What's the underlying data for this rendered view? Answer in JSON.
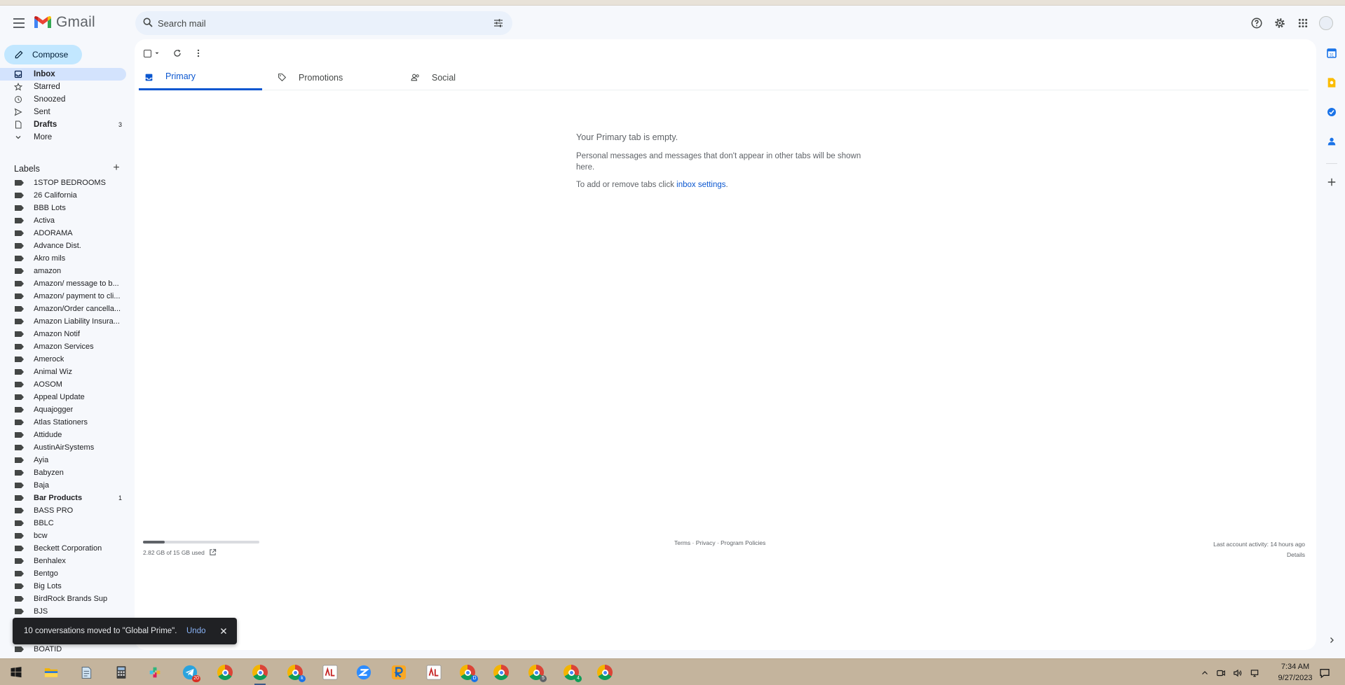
{
  "app": {
    "name": "Gmail"
  },
  "search": {
    "placeholder": "Search mail"
  },
  "compose": {
    "label": "Compose"
  },
  "nav": [
    {
      "label": "Inbox",
      "icon": "inbox-icon",
      "active": true,
      "bold": true
    },
    {
      "label": "Starred",
      "icon": "star-icon"
    },
    {
      "label": "Snoozed",
      "icon": "clock-icon"
    },
    {
      "label": "Sent",
      "icon": "send-icon"
    },
    {
      "label": "Drafts",
      "icon": "draft-icon",
      "count": "3",
      "bold": true
    },
    {
      "label": "More",
      "icon": "chevron-down-icon"
    }
  ],
  "labels": {
    "heading": "Labels",
    "items": [
      {
        "label": "1STOP BEDROOMS"
      },
      {
        "label": "26 California"
      },
      {
        "label": "BBB Lots"
      },
      {
        "label": "Activa"
      },
      {
        "label": "ADORAMA"
      },
      {
        "label": "Advance Dist."
      },
      {
        "label": "Akro mils"
      },
      {
        "label": "amazon"
      },
      {
        "label": "Amazon/ message to b..."
      },
      {
        "label": "Amazon/ payment to cli..."
      },
      {
        "label": "Amazon/Order cancella..."
      },
      {
        "label": "Amazon Liability Insura..."
      },
      {
        "label": "Amazon Notif"
      },
      {
        "label": "Amazon Services"
      },
      {
        "label": "Amerock"
      },
      {
        "label": "Animal Wiz"
      },
      {
        "label": "AOSOM"
      },
      {
        "label": "Appeal Update"
      },
      {
        "label": "Aquajogger"
      },
      {
        "label": "Atlas Stationers"
      },
      {
        "label": "Attidude"
      },
      {
        "label": "AustinAirSystems"
      },
      {
        "label": "Ayia"
      },
      {
        "label": "Babyzen"
      },
      {
        "label": "Baja"
      },
      {
        "label": "Bar Products",
        "count": "1",
        "bold": true
      },
      {
        "label": "BASS PRO"
      },
      {
        "label": "BBLC"
      },
      {
        "label": "bcw"
      },
      {
        "label": "Beckett Corporation"
      },
      {
        "label": "Benhalex"
      },
      {
        "label": "Bentgo"
      },
      {
        "label": "Big Lots"
      },
      {
        "label": "BirdRock Brands Sup"
      },
      {
        "label": "BJS"
      },
      {
        "label": ""
      },
      {
        "label": ""
      },
      {
        "label": "BOATID"
      }
    ]
  },
  "tabs": [
    {
      "label": "Primary",
      "icon": "inbox-icon",
      "active": true
    },
    {
      "label": "Promotions",
      "icon": "tag-icon"
    },
    {
      "label": "Social",
      "icon": "people-icon"
    }
  ],
  "empty_state": {
    "title": "Your Primary tab is empty.",
    "body": "Personal messages and messages that don't appear in other tabs will be shown here.",
    "settings_prefix": "To add or remove tabs click ",
    "settings_link": "inbox settings",
    "settings_suffix": "."
  },
  "footer": {
    "storage_text": "2.82 GB of 15 GB used",
    "storage_fraction": 0.188,
    "terms": "Terms",
    "privacy": "Privacy",
    "policies": "Program Policies",
    "sep": " · ",
    "activity": "Last account activity: 14 hours ago",
    "details": "Details"
  },
  "toast": {
    "message": "10 conversations moved to \"Global Prime\".",
    "undo": "Undo"
  },
  "taskbar": {
    "time": "7:34 AM",
    "date": "9/27/2023",
    "apps": [
      {
        "name": "start-icon"
      },
      {
        "name": "file-explorer-icon"
      },
      {
        "name": "notepad-icon"
      },
      {
        "name": "calculator-icon"
      },
      {
        "name": "slack-icon"
      },
      {
        "name": "telegram-icon",
        "badge": "20"
      },
      {
        "name": "chrome-icon"
      },
      {
        "name": "chrome-icon",
        "open": true
      },
      {
        "name": "chrome-icon",
        "badge": "k"
      },
      {
        "name": "app-icon"
      },
      {
        "name": "zoom-icon"
      },
      {
        "name": "r-app-icon"
      },
      {
        "name": "app-icon"
      },
      {
        "name": "chrome-icon",
        "badge": "D"
      },
      {
        "name": "chrome-icon"
      },
      {
        "name": "chrome-icon",
        "badge": "5"
      },
      {
        "name": "chrome-icon",
        "badge": "4"
      },
      {
        "name": "chrome-icon"
      }
    ]
  },
  "colors": {
    "accent": "#0b57d0",
    "compose_bg": "#c2e7ff",
    "active_nav": "#d3e3fd",
    "taskbar": "#c4b49d"
  }
}
